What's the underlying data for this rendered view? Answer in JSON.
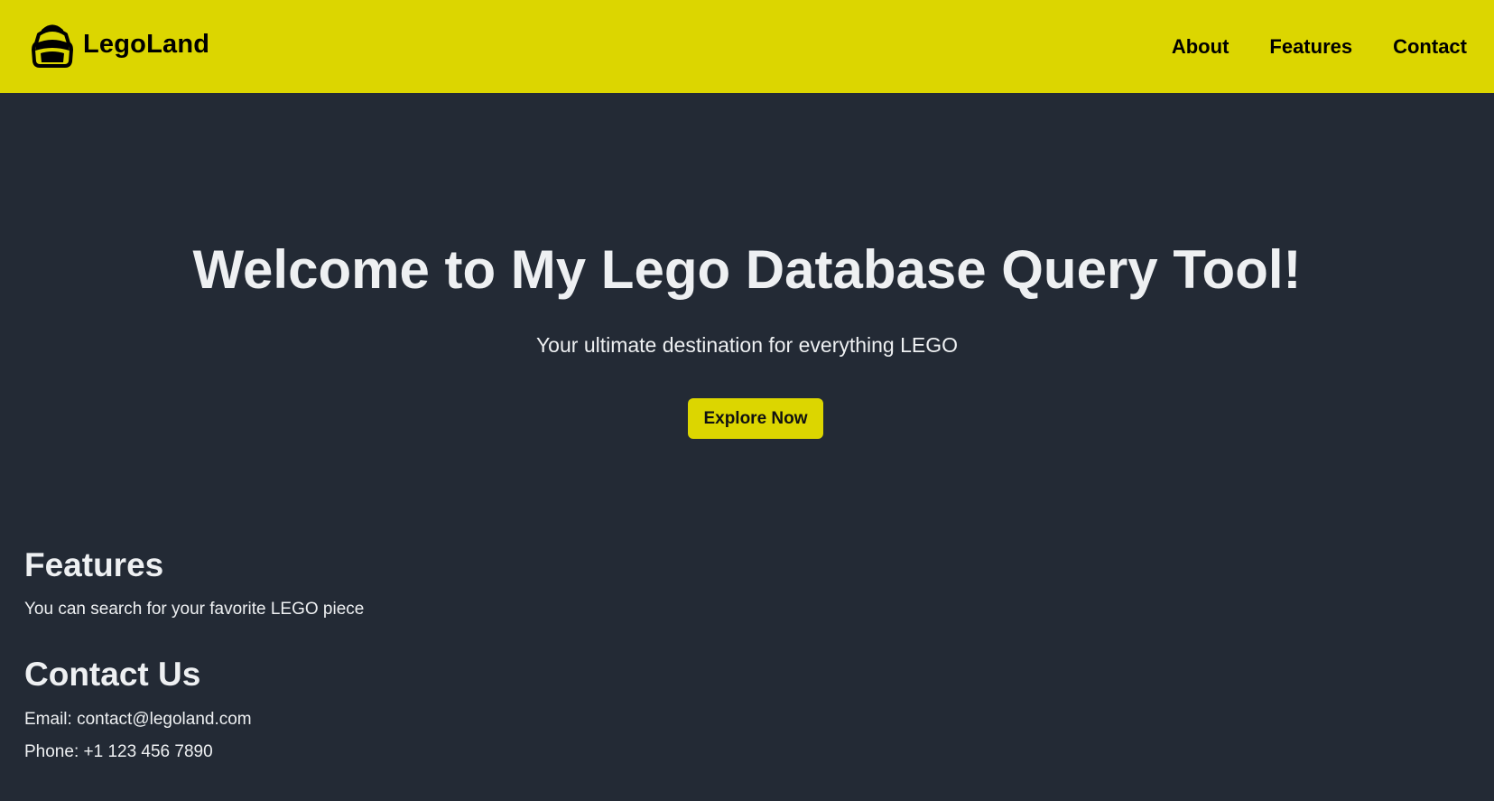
{
  "brand": {
    "name": "LegoLand",
    "logo_icon": "lego-minifig-head-icon"
  },
  "nav": {
    "items": [
      {
        "label": "About"
      },
      {
        "label": "Features"
      },
      {
        "label": "Contact"
      }
    ]
  },
  "hero": {
    "title": "Welcome to My Lego Database Query Tool!",
    "subtitle": "Your ultimate destination for everything LEGO",
    "cta_label": "Explore Now"
  },
  "features": {
    "heading": "Features",
    "text": "You can search for your favorite LEGO piece"
  },
  "contact": {
    "heading": "Contact Us",
    "email": "Email: contact@legoland.com",
    "phone": "Phone: +1 123 456 7890"
  },
  "colors": {
    "accent": "#dcd600",
    "background": "#232a35",
    "text": "#eef0f2"
  }
}
